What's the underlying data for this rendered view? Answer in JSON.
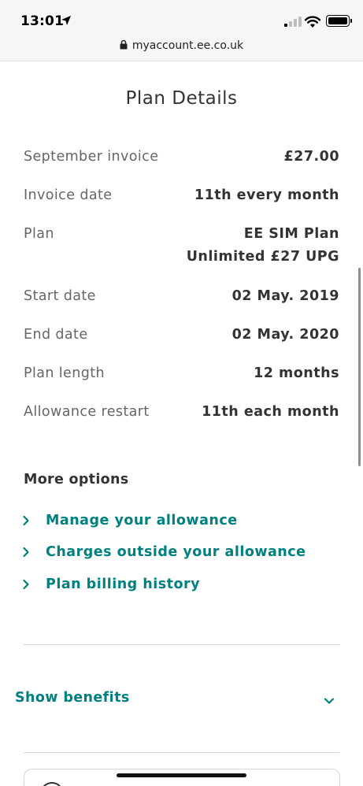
{
  "status_bar": {
    "time": "13:01"
  },
  "browser": {
    "url": "myaccount.ee.co.uk"
  },
  "page": {
    "title": "Plan Details"
  },
  "details": [
    {
      "label": "September invoice",
      "value": "£27.00"
    },
    {
      "label": "Invoice date",
      "value": "11th every month"
    },
    {
      "label": "Plan",
      "value_line1": "EE SIM Plan",
      "value_line2": "Unlimited £27 UPG"
    },
    {
      "label": "Start date",
      "value": "02 May. 2019"
    },
    {
      "label": "End date",
      "value": "02 May. 2020"
    },
    {
      "label": "Plan length",
      "value": "12 months"
    },
    {
      "label": "Allowance restart",
      "value": "11th each month"
    }
  ],
  "more_options": {
    "heading": "More options",
    "links": [
      {
        "label": "Manage your allowance"
      },
      {
        "label": "Charges outside your allowance"
      },
      {
        "label": "Plan billing history"
      }
    ]
  },
  "benefits": {
    "label": "Show benefits"
  },
  "colors": {
    "accent": "#00807f",
    "label_gray": "#666666",
    "value_dark": "#333333"
  },
  "icons": [
    "location-arrow-icon",
    "signal-icon",
    "wifi-icon",
    "battery-icon",
    "lock-icon",
    "chevron-right-icon",
    "chevron-down-icon"
  ]
}
